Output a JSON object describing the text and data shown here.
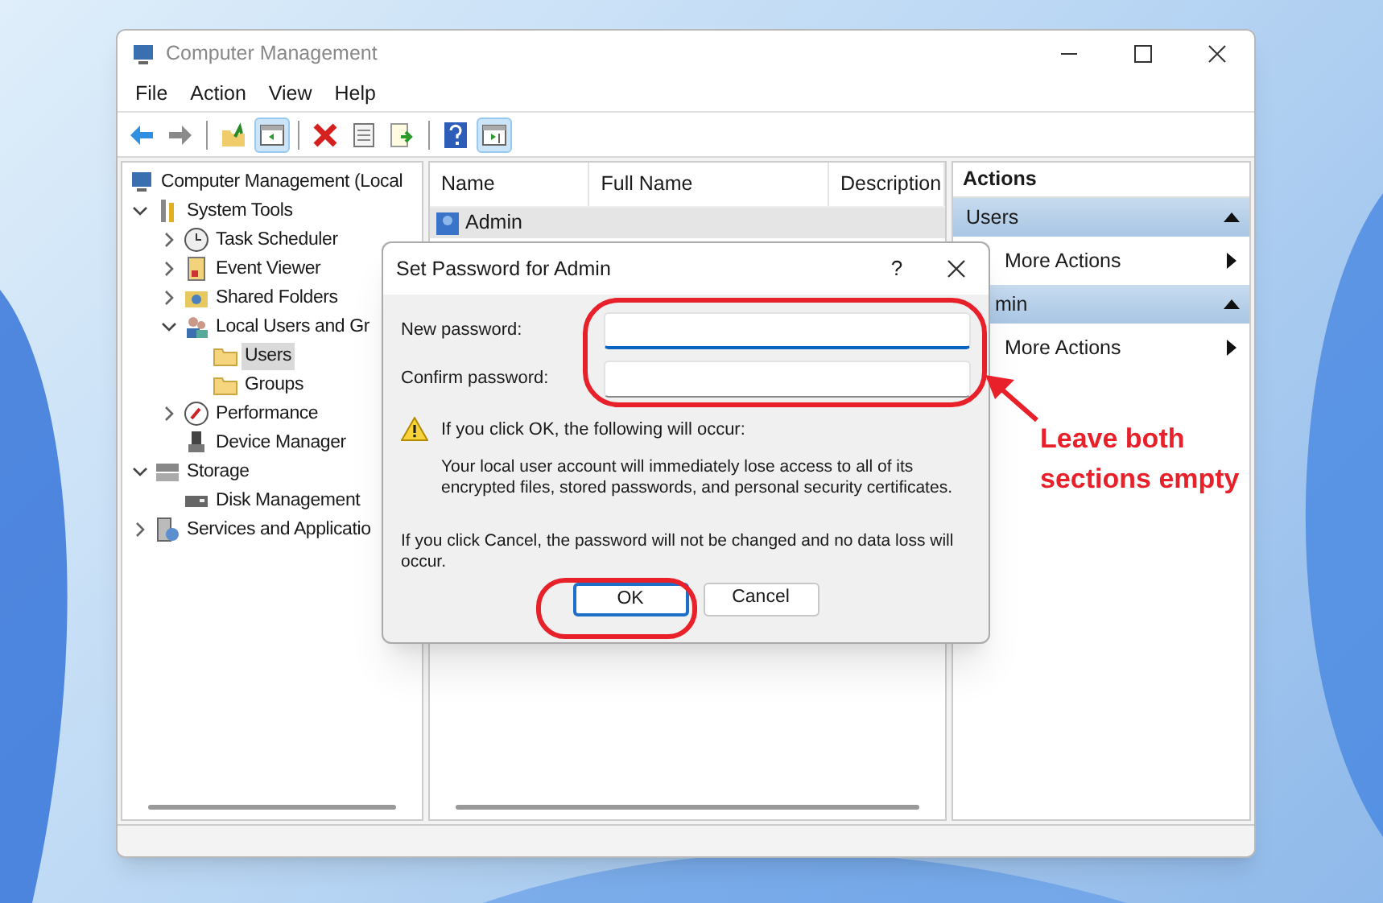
{
  "window": {
    "title": "Computer Management"
  },
  "menu": [
    "File",
    "Action",
    "View",
    "Help"
  ],
  "toolbar": [
    {
      "kind": "back"
    },
    {
      "kind": "forward"
    },
    {
      "kind": "sep"
    },
    {
      "kind": "up"
    },
    {
      "kind": "tree",
      "pressed": true
    },
    {
      "kind": "sep"
    },
    {
      "kind": "delete"
    },
    {
      "kind": "properties"
    },
    {
      "kind": "export"
    },
    {
      "kind": "sep"
    },
    {
      "kind": "help"
    },
    {
      "kind": "actionpane",
      "pressed": true
    }
  ],
  "tree": [
    {
      "label": "Computer Management (Local",
      "kind": "computer",
      "selected": false,
      "children": [
        {
          "label": "System Tools",
          "kind": "tools",
          "expanded": true,
          "selected": false,
          "children": [
            {
              "label": "Task Scheduler",
              "kind": "clock",
              "expanded": false,
              "selected": false
            },
            {
              "label": "Event Viewer",
              "kind": "event",
              "expanded": false,
              "selected": false
            },
            {
              "label": "Shared Folders",
              "kind": "share",
              "expanded": false,
              "selected": false
            },
            {
              "label": "Local Users and Gr",
              "kind": "users",
              "expanded": true,
              "selected": false,
              "children": [
                {
                  "label": "Users",
                  "kind": "folder",
                  "selected": true
                },
                {
                  "label": "Groups",
                  "kind": "folder",
                  "selected": false
                }
              ]
            },
            {
              "label": "Performance",
              "kind": "perf",
              "expanded": false,
              "selected": false
            },
            {
              "label": "Device Manager",
              "kind": "device",
              "selected": false
            }
          ]
        },
        {
          "label": "Storage",
          "kind": "storage",
          "expanded": true,
          "selected": false,
          "children": [
            {
              "label": "Disk Management",
              "kind": "disk",
              "selected": false
            }
          ]
        },
        {
          "label": "Services and Applicatio",
          "kind": "services",
          "expanded": false,
          "selected": false
        }
      ]
    }
  ],
  "list": {
    "columns": [
      "Name",
      "Full Name",
      "Description"
    ],
    "rows": [
      {
        "name": "Admin",
        "selected": true
      }
    ]
  },
  "actions": {
    "title": "Actions",
    "sections": [
      {
        "title": "Users",
        "items": [
          "More Actions"
        ]
      },
      {
        "title": "min",
        "items": [
          "More Actions"
        ]
      }
    ]
  },
  "dialog": {
    "title": "Set Password for Admin",
    "help": "?",
    "fields": [
      {
        "label": "New password:",
        "focused": true
      },
      {
        "label": "Confirm password:",
        "focused": false
      }
    ],
    "warning_title": "If you click OK, the following will occur:",
    "warning_text": "Your local user account will immediately lose access to all of its encrypted files, stored passwords, and personal security certificates.",
    "cancel_text": "If you click Cancel, the password will not be changed and no data loss will occur.",
    "buttons": [
      {
        "label": "OK",
        "default": true
      },
      {
        "label": "Cancel",
        "default": false
      }
    ]
  },
  "annotation": {
    "lines": [
      "Leave both",
      "sections empty"
    ]
  }
}
